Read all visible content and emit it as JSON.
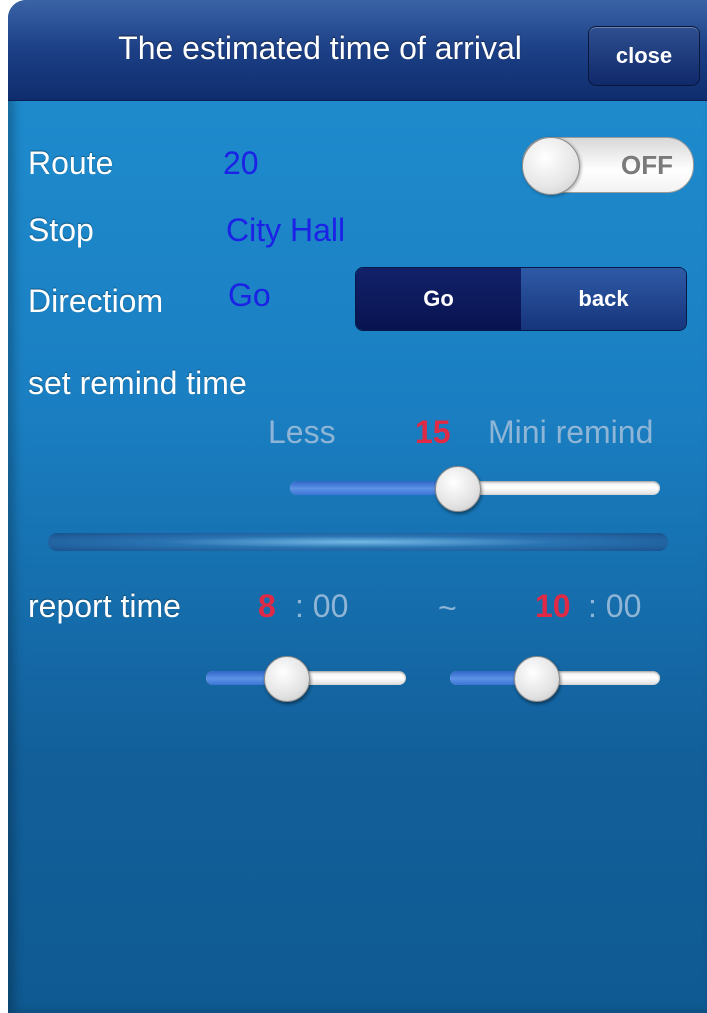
{
  "header": {
    "title": "The estimated time of arrival",
    "close_label": "close"
  },
  "route": {
    "label": "Route",
    "value": "20"
  },
  "toggle": {
    "label": "OFF",
    "state": "off"
  },
  "stop": {
    "label": "Stop",
    "value": "City Hall"
  },
  "direction": {
    "label": "Directiom",
    "value": "Go",
    "segments": [
      "Go",
      "back"
    ],
    "selected": "Go"
  },
  "remind": {
    "section_label": "set remind time",
    "less_label": "Less",
    "value": "15",
    "unit_label": "Mini remind",
    "slider_fraction": 0.45
  },
  "report": {
    "label": "report time",
    "start_hour": "8",
    "start_minutes": ": 00",
    "separator": "~",
    "end_hour": "10",
    "end_minutes": ": 00",
    "start_slider_fraction": 0.4,
    "end_slider_fraction": 0.41
  },
  "colors": {
    "accent_value": "#1b22e6",
    "highlight_number": "#e02a45",
    "title_bar": "#1c3f85",
    "background": "#1a7fc2"
  }
}
